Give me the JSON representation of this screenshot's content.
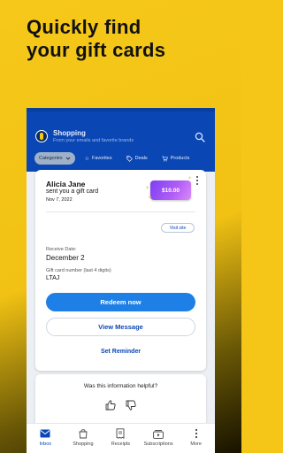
{
  "headline": {
    "line1": "Quickly find",
    "line2": "your gift cards"
  },
  "app": {
    "title": "Shopping",
    "subtitle": "From your emails and favorite brands",
    "chips": [
      {
        "label": "Categories",
        "icon": "chevron-down-icon",
        "selected": true
      },
      {
        "label": "Favorites",
        "icon": "star-icon",
        "selected": false
      },
      {
        "label": "Deals",
        "icon": "tag-icon",
        "selected": false
      },
      {
        "label": "Products",
        "icon": "cart-icon",
        "selected": false
      }
    ]
  },
  "gift": {
    "sender": "Alicia Jane",
    "message": "sent you a gift card",
    "date": "Nov 7, 2022",
    "amount": "$10.00",
    "visit_label": "Visit site",
    "receive_label": "Receive Date:",
    "receive_value": "December 2",
    "card_number_label": "Gift card number (last 4 digits)",
    "card_number_value": "LTAJ",
    "redeem_label": "Redeem now",
    "view_label": "View Message",
    "reminder_label": "Set Reminder"
  },
  "feedback": {
    "question": "Was this information helpful?"
  },
  "nav": [
    {
      "label": "Inbox",
      "icon": "inbox-icon",
      "active": true
    },
    {
      "label": "Shopping",
      "icon": "shopping-bag-icon",
      "active": false
    },
    {
      "label": "Receipts",
      "icon": "receipt-icon",
      "active": false
    },
    {
      "label": "Subscriptions",
      "icon": "subscriptions-icon",
      "active": false
    },
    {
      "label": "More",
      "icon": "more-vertical-icon",
      "active": false
    }
  ],
  "colors": {
    "brand_blue": "#0a46b4",
    "accent_yellow": "#f6c81a",
    "cta_blue": "#1e7fe6",
    "gift_purple": "#7b3ff2"
  }
}
